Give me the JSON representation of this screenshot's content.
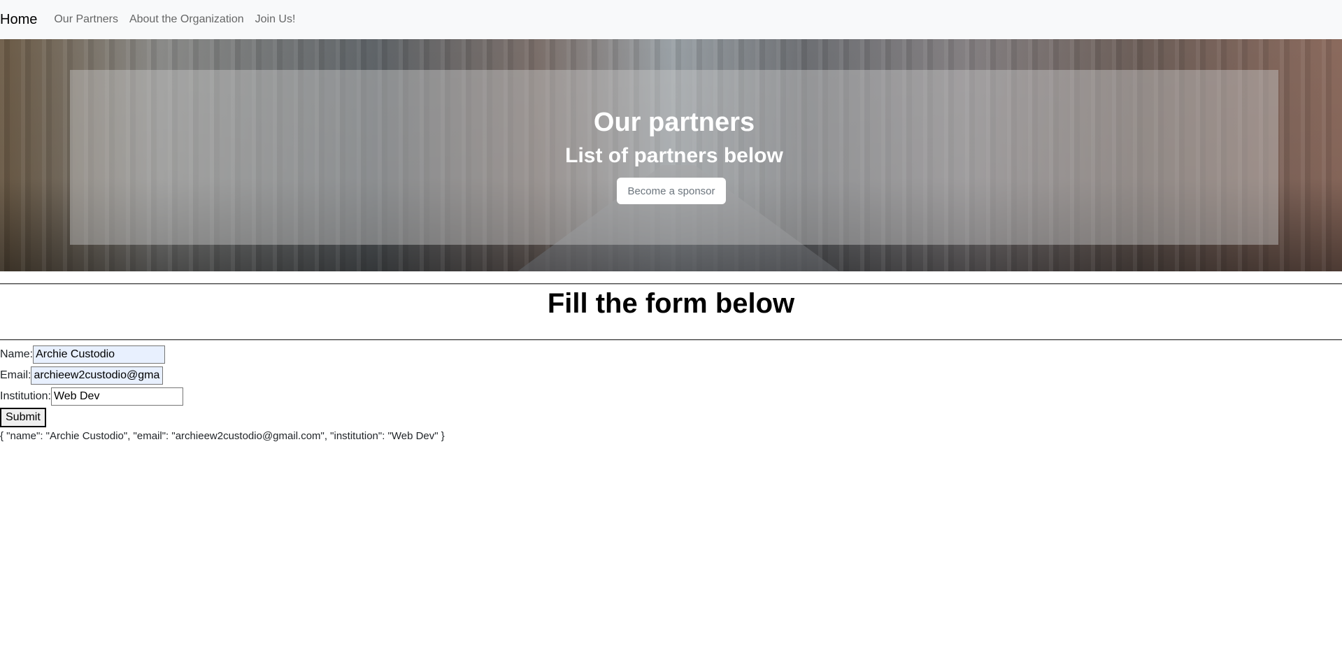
{
  "nav": {
    "brand": "Home",
    "links": [
      "Our Partners",
      "About the Organization",
      "Join Us!"
    ]
  },
  "hero": {
    "title": "Our partners",
    "subtitle": "List of partners below",
    "button_label": "Become a sponsor"
  },
  "form": {
    "heading": "Fill the form below",
    "name_label": "Name:",
    "name_value": "Archie Custodio",
    "email_label": "Email:",
    "email_value": "archieew2custodio@gmail.com",
    "institution_label": "Institution:",
    "institution_value": "Web Dev",
    "submit_label": "Submit"
  },
  "output": {
    "json_text": "{ \"name\": \"Archie Custodio\", \"email\": \"archieew2custodio@gmail.com\", \"institution\": \"Web Dev\" }"
  }
}
